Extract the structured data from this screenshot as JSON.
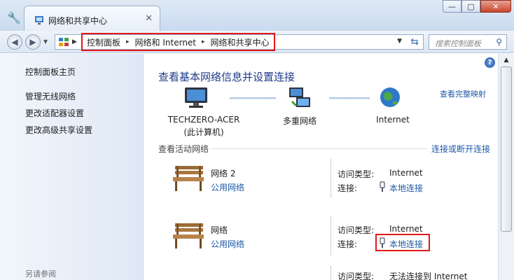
{
  "window": {
    "tab_title": "网络和共享中心",
    "tab_close": "✕",
    "controls": {
      "minimize": "—",
      "maximize": "▢",
      "close": "✕"
    }
  },
  "addressbar": {
    "crumbs": [
      "控制面板",
      "网络和 Internet",
      "网络和共享中心"
    ],
    "separator": "▸",
    "search_placeholder": "搜索控制面板"
  },
  "sidebar": {
    "home": "控制面板主页",
    "links": [
      "管理无线网络",
      "更改适配器设置",
      "更改高级共享设置"
    ],
    "see_also": "另请参阅"
  },
  "main": {
    "help": "?",
    "heading": "查看基本网络信息并设置连接",
    "full_map": "查看完整映射",
    "map_nodes": [
      {
        "label": "TECHZERO-ACER",
        "sub": "(此计算机)"
      },
      {
        "label": "多重网络",
        "sub": ""
      },
      {
        "label": "Internet",
        "sub": ""
      }
    ],
    "active_title": "查看活动网络",
    "connect_link": "连接或断开连接",
    "networks": [
      {
        "name": "网络  2",
        "type": "公用网络",
        "access_label": "访问类型:",
        "access": "Internet",
        "conn_label": "连接:",
        "conn": "本地连接"
      },
      {
        "name": "网络",
        "type": "公用网络",
        "access_label": "访问类型:",
        "access": "Internet",
        "conn_label": "连接:",
        "conn": "本地连接"
      }
    ],
    "partial": {
      "access_label": "访问类型:",
      "access": "无法连接到 Internet"
    }
  },
  "colors": {
    "link": "#1e5aa8",
    "heading": "#1e3b8a",
    "highlight": "#e21818"
  }
}
